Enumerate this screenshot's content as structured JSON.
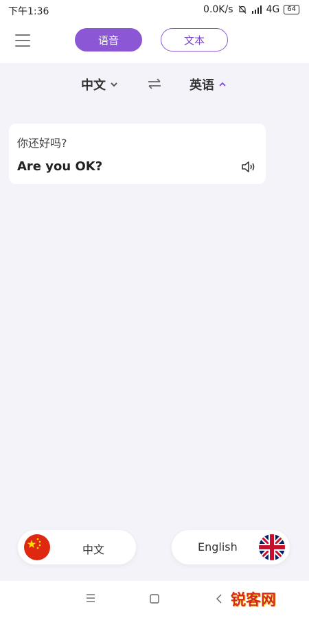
{
  "status_bar": {
    "time": "下午1:36",
    "speed": "0.0K/s",
    "network": "4G",
    "battery": "64"
  },
  "top_bar": {
    "mode_voice": "语音",
    "mode_text": "文本"
  },
  "lang_bar": {
    "source_language": "中文",
    "target_language": "英语"
  },
  "translation": {
    "source_text": "你还好吗?",
    "target_text": "Are you OK?"
  },
  "bottom_languages": {
    "left_label": "中文",
    "right_label": "English"
  },
  "watermark": {
    "text": "锐客网"
  },
  "icons": [
    "menu-icon",
    "swap-icon",
    "chevron-down-icon",
    "chevron-up-icon",
    "speaker-icon",
    "china-flag-icon",
    "uk-flag-icon",
    "nav-menu-icon",
    "nav-home-icon",
    "nav-back-icon"
  ],
  "colors": {
    "accent": "#8b57d4",
    "background": "#f3f3f9"
  }
}
